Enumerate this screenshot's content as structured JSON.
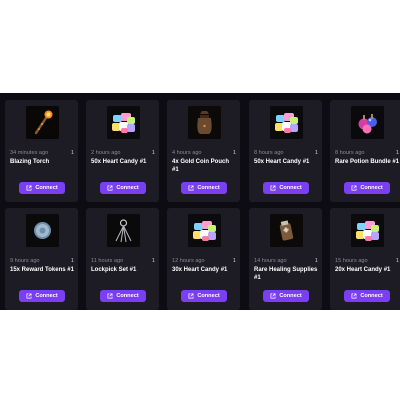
{
  "colors": {
    "panel_bg": "#0d0c12",
    "card_bg": "#1d1b24",
    "accent": "#7a3ff2"
  },
  "button_label": "Connect",
  "button_icon": "external-link-icon",
  "items": [
    {
      "time": "34 minutes ago",
      "qty": "1",
      "name": "Blazing Torch",
      "icon": "torch-icon"
    },
    {
      "time": "2 hours ago",
      "qty": "1",
      "name": "50x Heart Candy #1",
      "icon": "heart-candy-icon"
    },
    {
      "time": "4 hours ago",
      "qty": "1",
      "name": "4x Gold Coin Pouch #1",
      "icon": "coin-pouch-icon"
    },
    {
      "time": "8 hours ago",
      "qty": "1",
      "name": "50x Heart Candy #1",
      "icon": "heart-candy-icon"
    },
    {
      "time": "8 hours ago",
      "qty": "1",
      "name": "Rare Potion Bundle #1",
      "icon": "potion-bundle-icon"
    },
    {
      "time": "9 hours ago",
      "qty": "1",
      "name": "15x Reward Tokens #1",
      "icon": "reward-token-icon"
    },
    {
      "time": "11 hours ago",
      "qty": "1",
      "name": "Lockpick Set #1",
      "icon": "lockpick-icon"
    },
    {
      "time": "12 hours ago",
      "qty": "1",
      "name": "30x Heart Candy #1",
      "icon": "heart-candy-icon"
    },
    {
      "time": "14 hours ago",
      "qty": "1",
      "name": "Rare Healing Supplies #1",
      "icon": "healing-supplies-icon"
    },
    {
      "time": "15 hours ago",
      "qty": "1",
      "name": "20x Heart Candy #1",
      "icon": "heart-candy-icon"
    }
  ]
}
